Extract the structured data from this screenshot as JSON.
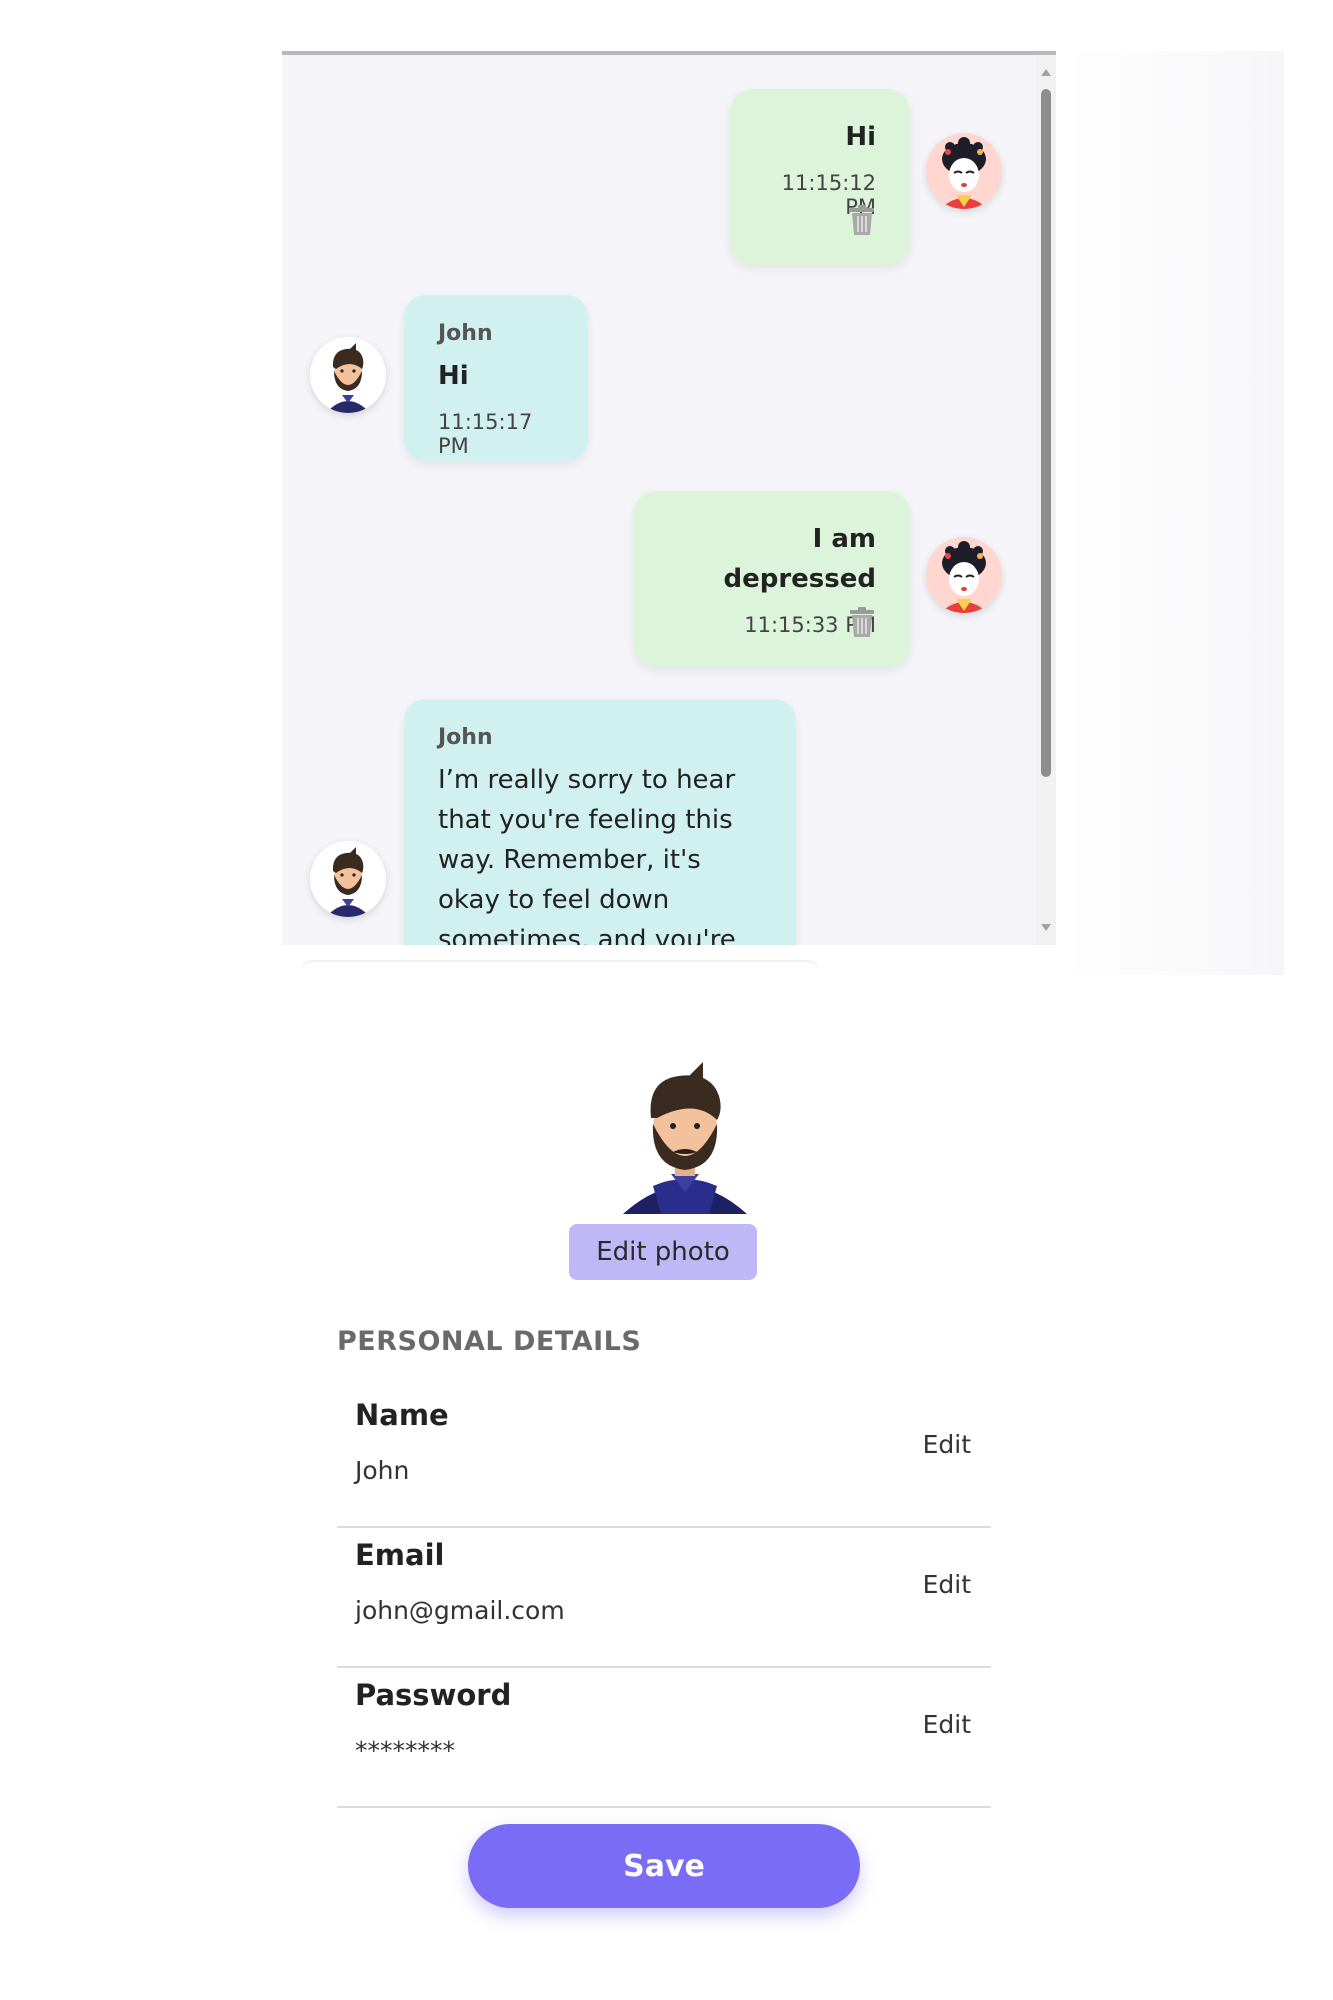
{
  "chat": {
    "messages": [
      {
        "side": "me",
        "text": "Hi",
        "time": "11:15:12 PM"
      },
      {
        "side": "them",
        "sender": "John",
        "text": "Hi",
        "time": "11:15:17 PM"
      },
      {
        "side": "me",
        "text": "I am depressed",
        "time": "11:15:33 PM"
      },
      {
        "side": "them",
        "sender": "John",
        "text": "I’m really sorry to hear that you're feeling this way. Remember, it's okay to feel down sometimes, and you're"
      }
    ]
  },
  "profile": {
    "edit_photo_label": "Edit photo",
    "section_title": "PERSONAL DETAILS",
    "fields": [
      {
        "label": "Name",
        "value": "John",
        "edit": "Edit"
      },
      {
        "label": "Email",
        "value": "john@gmail.com",
        "edit": "Edit"
      },
      {
        "label": "Password",
        "value": "********",
        "edit": "Edit"
      }
    ],
    "save_label": "Save"
  },
  "colors": {
    "my_bubble": "#dcf5da",
    "their_bubble": "#d1f0f0",
    "accent": "#7b6cf6",
    "edit_photo_bg": "#bfb8f7"
  },
  "icons": [
    "trash-icon",
    "geisha-avatar-icon",
    "bearded-man-avatar-icon",
    "scroll-up-arrow",
    "scroll-down-arrow"
  ]
}
